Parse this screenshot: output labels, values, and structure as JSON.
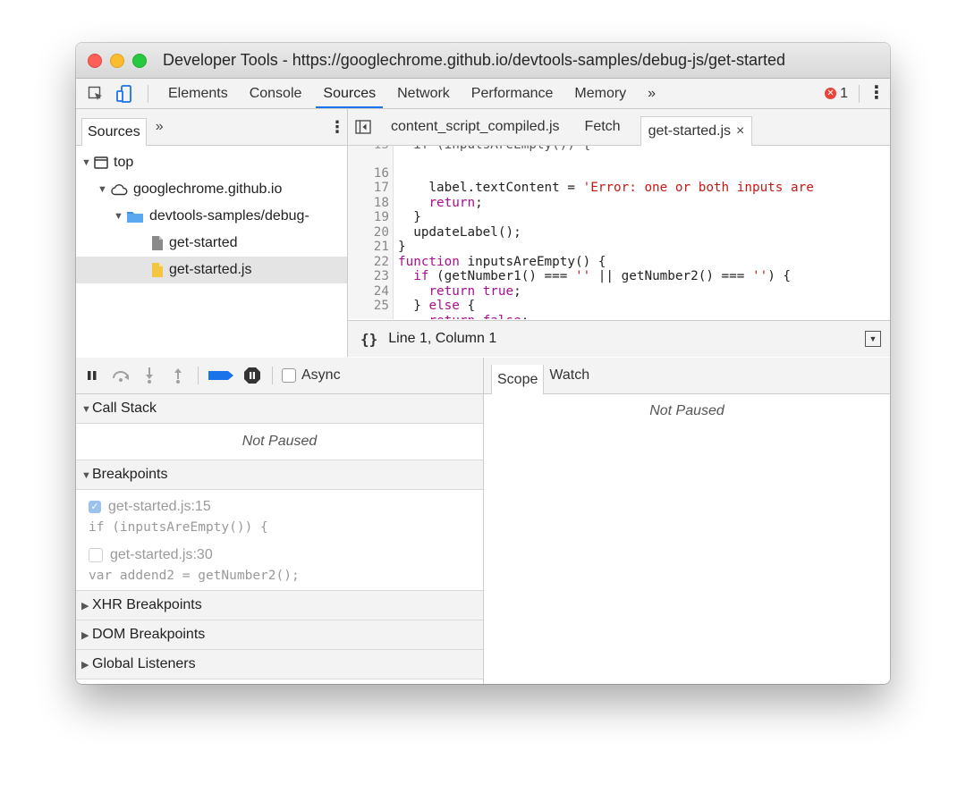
{
  "window": {
    "title": "Developer Tools - https://googlechrome.github.io/devtools-samples/debug-js/get-started"
  },
  "main_tabs": [
    "Elements",
    "Console",
    "Sources",
    "Network",
    "Performance",
    "Memory"
  ],
  "active_main_tab": "Sources",
  "overflow_chevron": "»",
  "error_count": "1",
  "navigator": {
    "tab": "Sources",
    "overflow": "»",
    "tree": [
      {
        "label": "top",
        "icon": "frame-icon"
      },
      {
        "label": "googlechrome.github.io",
        "icon": "cloud-icon"
      },
      {
        "label": "devtools-samples/debug-",
        "icon": "folder-icon"
      },
      {
        "label": "get-started",
        "icon": "file-icon"
      },
      {
        "label": "get-started.js",
        "icon": "js-file-icon",
        "selected": true
      }
    ]
  },
  "editor": {
    "tabs": [
      "content_script_compiled.js",
      "Fetch",
      "get-started.js"
    ],
    "active_tab": "get-started.js",
    "close_glyph": "×",
    "lines": [
      {
        "n": "16",
        "text": "    label.textContent = 'Error: one or both inputs are"
      },
      {
        "n": "17",
        "text": "    return;"
      },
      {
        "n": "18",
        "text": "  }"
      },
      {
        "n": "19",
        "text": "  updateLabel();"
      },
      {
        "n": "20",
        "text": "}"
      },
      {
        "n": "21",
        "text": "function inputsAreEmpty() {"
      },
      {
        "n": "22",
        "text": "  if (getNumber1() === '' || getNumber2() === '') {"
      },
      {
        "n": "23",
        "text": "    return true;"
      },
      {
        "n": "24",
        "text": "  } else {"
      },
      {
        "n": "25",
        "text": "    return false;"
      }
    ],
    "status_braces": "{}",
    "status_position": "Line 1, Column 1"
  },
  "debugger": {
    "async_label": "Async",
    "call_stack": {
      "label": "Call Stack",
      "message": "Not Paused"
    },
    "breakpoints": {
      "label": "Breakpoints",
      "items": [
        {
          "location": "get-started.js:15",
          "code": "if (inputsAreEmpty()) {",
          "checked": true
        },
        {
          "location": "get-started.js:30",
          "code": "var addend2 = getNumber2();",
          "checked": false
        }
      ]
    },
    "xhr_breakpoints": "XHR Breakpoints",
    "dom_breakpoints": "DOM Breakpoints",
    "global_listeners": "Global Listeners"
  },
  "scope_panel": {
    "tabs": [
      "Scope",
      "Watch"
    ],
    "active_tab": "Scope",
    "message": "Not Paused"
  },
  "colors": {
    "accent": "#1a73e8",
    "keyword": "#aa0d91",
    "string": "#c41a16",
    "error": "#e8443a"
  }
}
